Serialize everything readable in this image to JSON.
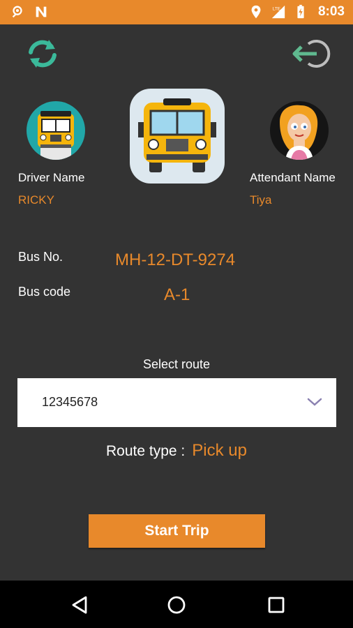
{
  "status_bar": {
    "time": "8:03",
    "network": "LTE",
    "icons": [
      "location-pin-icon",
      "n-notification-icon",
      "location-icon",
      "lte-signal-icon",
      "battery-charging-icon"
    ]
  },
  "header": {
    "refresh_icon": "refresh-icon",
    "logout_icon": "logout-icon",
    "accent_refresh": "#3bb99a",
    "accent_logout": "#5fb98f"
  },
  "driver": {
    "label": "Driver Name",
    "value": "RICKY"
  },
  "attendant": {
    "label": "Attendant Name",
    "value": "Tiya"
  },
  "bus": {
    "number_label": "Bus No.",
    "number_value": "MH-12-DT-9274",
    "code_label": "Bus code",
    "code_value": "A-1"
  },
  "route": {
    "select_label": "Select route",
    "selected_value": "12345678",
    "type_label": "Route type :",
    "type_value": "Pick up"
  },
  "actions": {
    "start_trip": "Start Trip"
  },
  "colors": {
    "accent": "#e8892b",
    "background": "#333333",
    "status_bar": "#e8892b"
  }
}
